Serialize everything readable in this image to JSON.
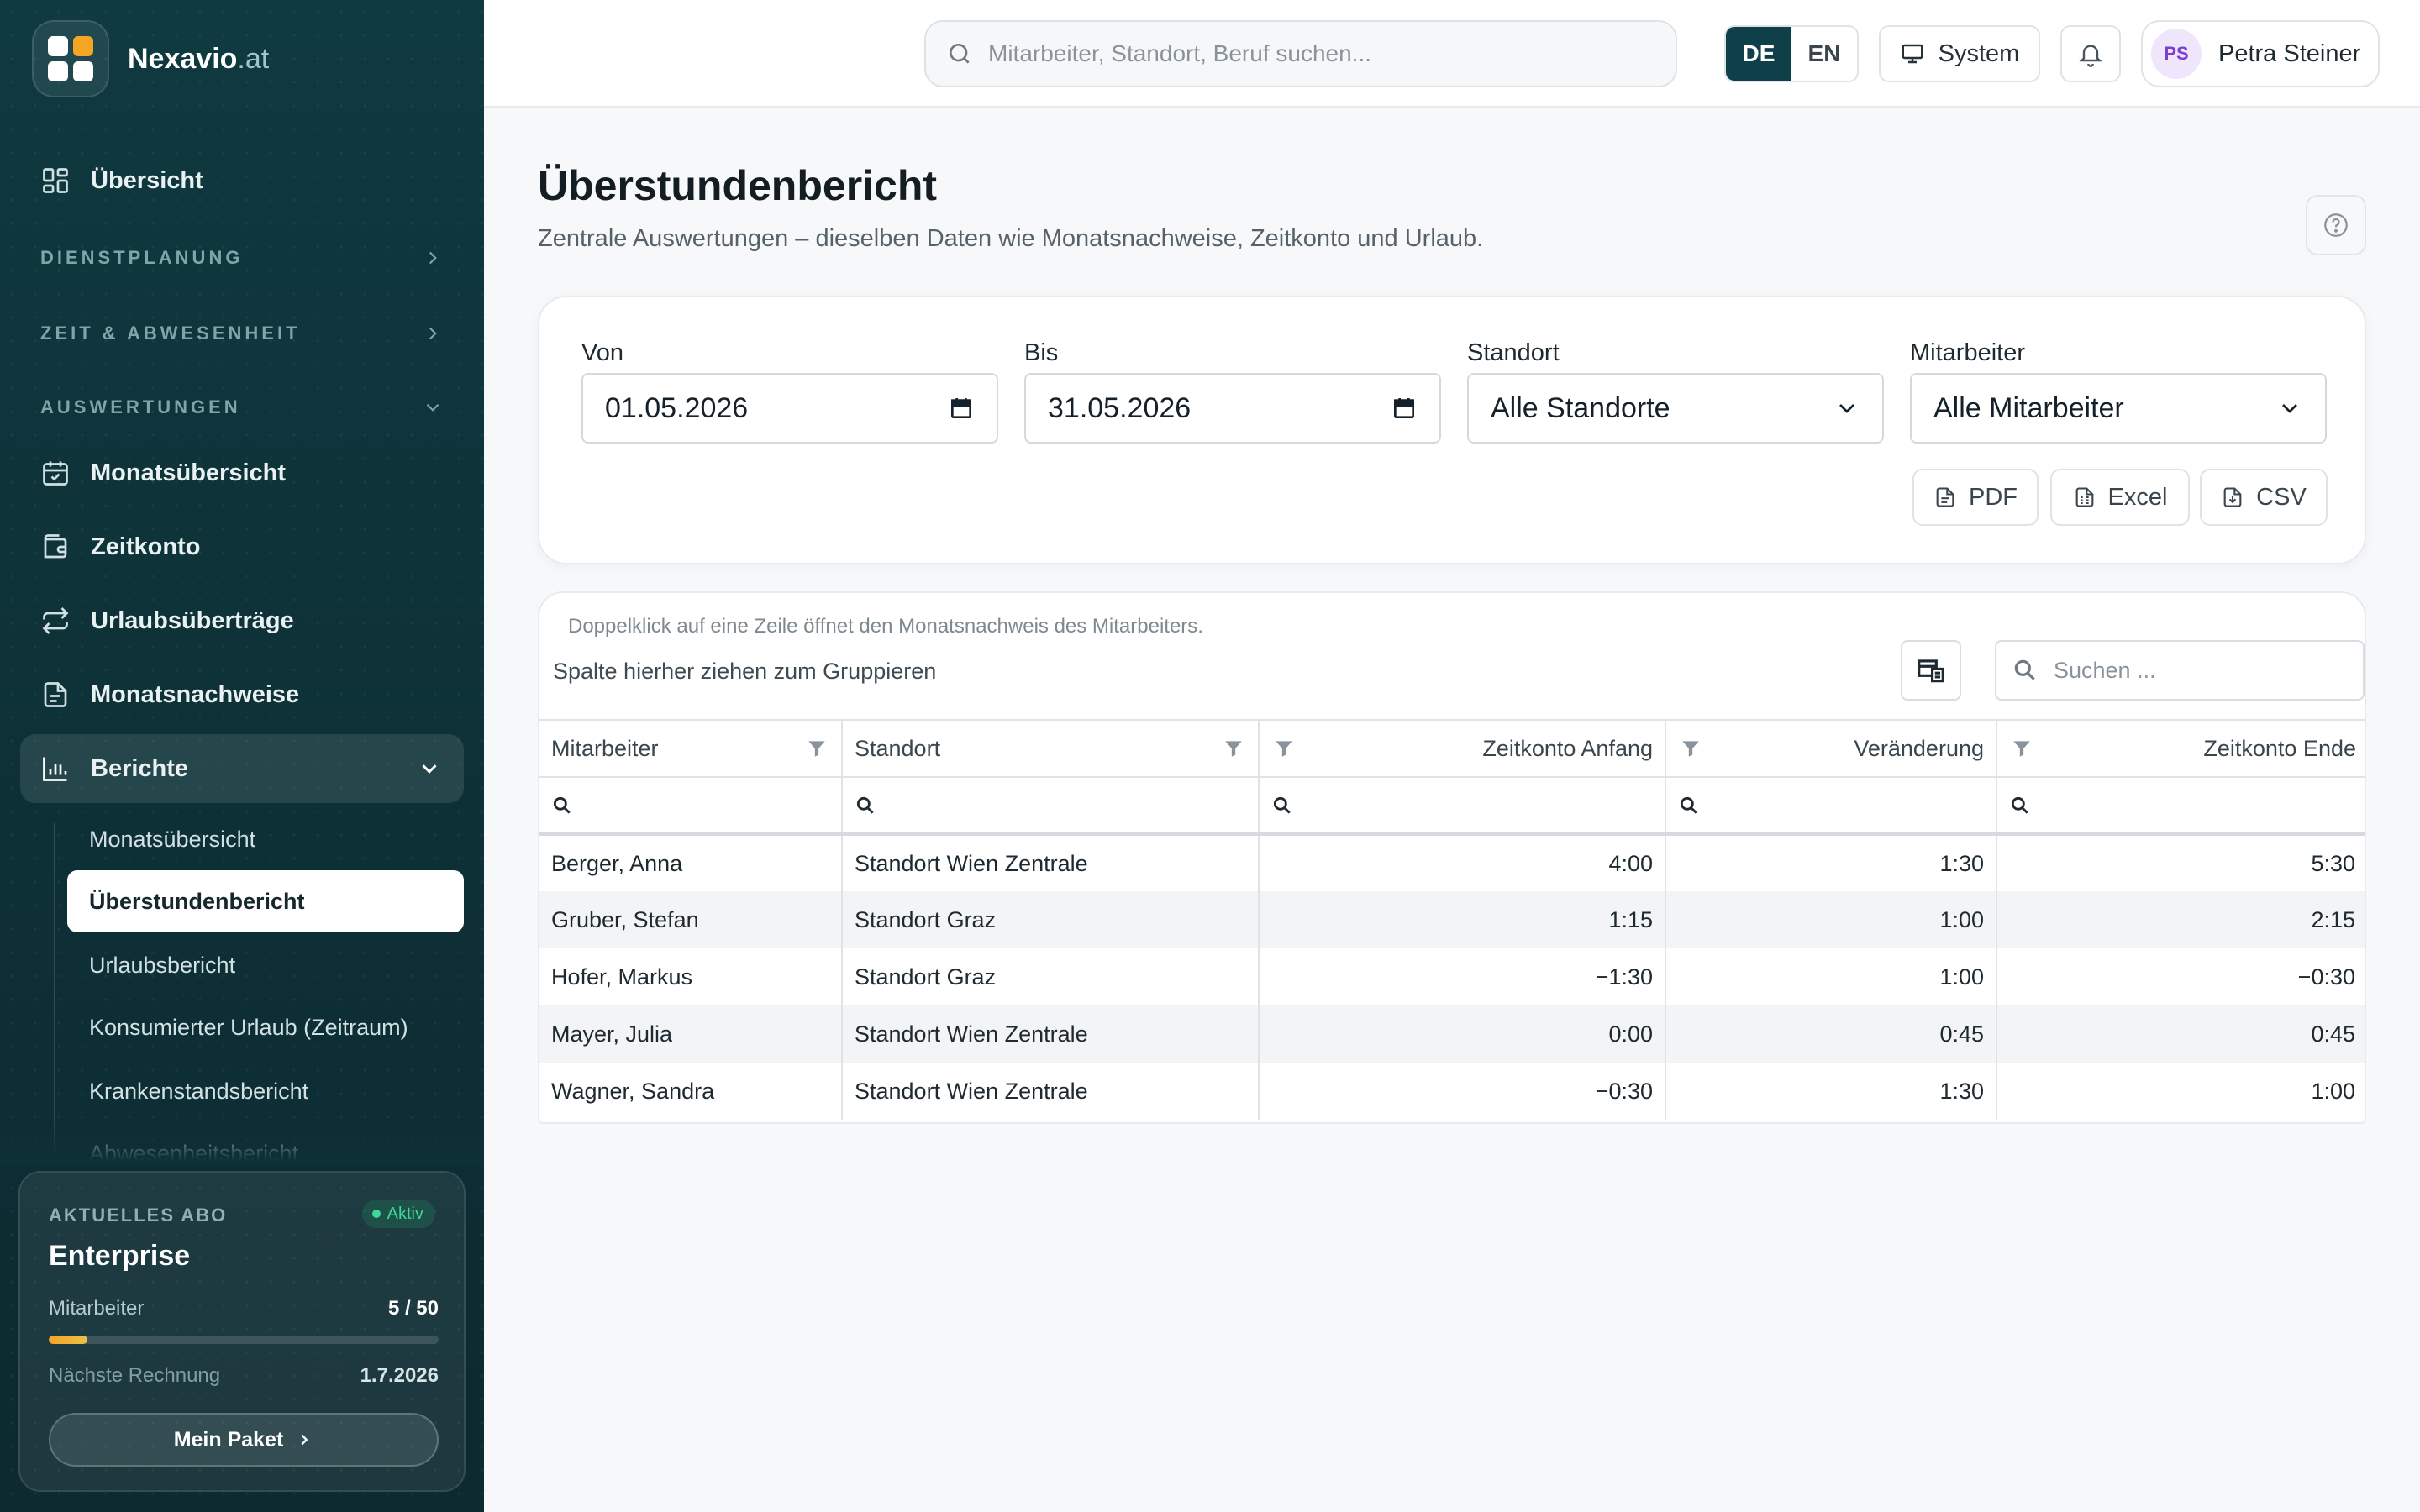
{
  "brand": {
    "name": "Nexavio",
    "tld": ".at"
  },
  "sidebar": {
    "overview": "Übersicht",
    "sections": {
      "planning": "DIENSTPLANUNG",
      "time": "ZEIT & ABWESENHEIT",
      "reports": "AUSWERTUNGEN"
    },
    "items": [
      {
        "label": "Monatsübersicht",
        "icon": "calendar-check-icon"
      },
      {
        "label": "Zeitkonto",
        "icon": "wallet-icon"
      },
      {
        "label": "Urlaubsüberträge",
        "icon": "repeat-icon"
      },
      {
        "label": "Monatsnachweise",
        "icon": "document-icon"
      },
      {
        "label": "Berichte",
        "icon": "bar-chart-icon"
      }
    ],
    "subitems": [
      "Monatsübersicht",
      "Überstundenbericht",
      "Urlaubsbericht",
      "Konsumierter Urlaub (Zeitraum)",
      "Krankenstandsbericht",
      "Abwesenheitsbericht"
    ]
  },
  "plan": {
    "label": "AKTUELLES ABO",
    "badge": "Aktiv",
    "name": "Enterprise",
    "employees_label": "Mitarbeiter",
    "employees_value": "5 / 50",
    "employees_used": 5,
    "employees_max": 50,
    "next_invoice_label": "Nächste Rechnung",
    "next_invoice_value": "1.7.2026",
    "button": "Mein Paket"
  },
  "topbar": {
    "search_placeholder": "Mitarbeiter, Standort, Beruf suchen...",
    "lang_de": "DE",
    "lang_en": "EN",
    "theme": "System",
    "user_initials": "PS",
    "user_name": "Petra Steiner"
  },
  "page": {
    "title": "Überstundenbericht",
    "subtitle": "Zentrale Auswertungen – dieselben Daten wie Monatsnachweise, Zeitkonto und Urlaub."
  },
  "filters": {
    "from_label": "Von",
    "from_value": "01.05.2026",
    "to_label": "Bis",
    "to_value": "31.05.2026",
    "location_label": "Standort",
    "location_value": "Alle Standorte",
    "employee_label": "Mitarbeiter",
    "employee_value": "Alle Mitarbeiter",
    "export": {
      "pdf": "PDF",
      "excel": "Excel",
      "csv": "CSV"
    }
  },
  "grid": {
    "hint": "Doppelklick auf eine Zeile öffnet den Monatsnachweis des Mitarbeiters.",
    "group_hint": "Spalte hierher ziehen zum Gruppieren",
    "search_placeholder": "Suchen ...",
    "columns": [
      "Mitarbeiter",
      "Standort",
      "Zeitkonto Anfang",
      "Veränderung",
      "Zeitkonto Ende"
    ],
    "rows": [
      {
        "name": "Berger, Anna",
        "location": "Standort Wien Zentrale",
        "start": "4:00",
        "change": "1:30",
        "end": "5:30"
      },
      {
        "name": "Gruber, Stefan",
        "location": "Standort Graz",
        "start": "1:15",
        "change": "1:00",
        "end": "2:15"
      },
      {
        "name": "Hofer, Markus",
        "location": "Standort Graz",
        "start": "−1:30",
        "change": "1:00",
        "end": "−0:30"
      },
      {
        "name": "Mayer, Julia",
        "location": "Standort Wien Zentrale",
        "start": "0:00",
        "change": "0:45",
        "end": "0:45"
      },
      {
        "name": "Wagner, Sandra",
        "location": "Standort Wien Zentrale",
        "start": "−0:30",
        "change": "1:30",
        "end": "1:00"
      }
    ]
  }
}
